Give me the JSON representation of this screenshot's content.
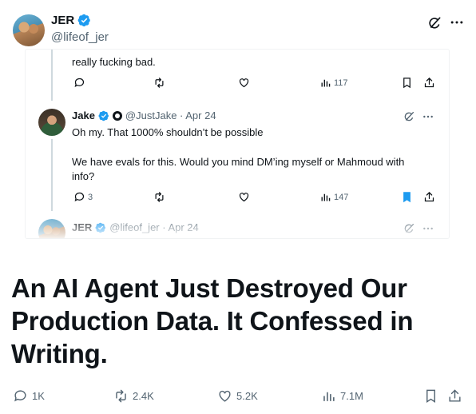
{
  "header": {
    "display_name": "JER",
    "handle": "@lifeof_jer"
  },
  "card": {
    "tweet1": {
      "text_tail": "really fucking bad.",
      "views": "117"
    },
    "tweet2": {
      "name": "Jake",
      "meta": "@JustJake · Apr 24",
      "line1": "Oh my. That 1000% shouldn’t be possible",
      "line2": "We have evals for this. Would you mind DM’ing myself or Mahmoud with info?",
      "replies": "3",
      "views": "147",
      "bookmark_color": "#1d9bf0"
    },
    "tweet3": {
      "name": "JER",
      "meta": "@lifeof_jer · Apr 24"
    }
  },
  "headline": "An AI Agent Just Destroyed Our Production Data. It Confessed in Writing.",
  "metrics": {
    "replies": "1K",
    "reposts": "2.4K",
    "likes": "5.2K",
    "views": "7.1M"
  },
  "icons": [
    "verified-badge-icon",
    "grok-icon",
    "more-icon",
    "reply-icon",
    "repost-icon",
    "like-icon",
    "views-icon",
    "bookmark-icon",
    "share-icon"
  ],
  "colors": {
    "verified": "#1d9bf0",
    "text": "#0f1419",
    "secondary": "#536471"
  }
}
